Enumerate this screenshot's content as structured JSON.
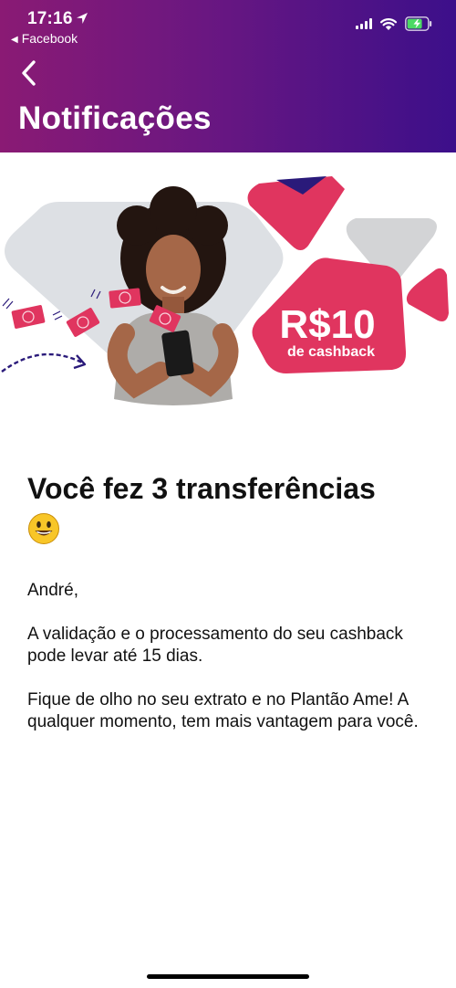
{
  "status_bar": {
    "time": "17:16",
    "back_to_app": "Facebook"
  },
  "header": {
    "title": "Notificações",
    "back_icon": "chevron-left-icon"
  },
  "banner": {
    "amount": "R$10",
    "amount_caption": "de cashback"
  },
  "message": {
    "headline": "Você fez 3 transferências",
    "emoji": "smiling-face-emoji",
    "greeting": "André,",
    "paragraph_1": "A validação e o processamento do seu cashback pode levar até 15 dias.",
    "paragraph_2": "Fique de olho no seu extrato e no Plantão Ame! A qualquer momento, tem mais vantagem para você."
  },
  "colors": {
    "header_gradient_start": "#8a1a74",
    "header_gradient_end": "#3c0f8a",
    "brand_pink": "#e0355f",
    "brand_navy": "#2a1a7a"
  }
}
